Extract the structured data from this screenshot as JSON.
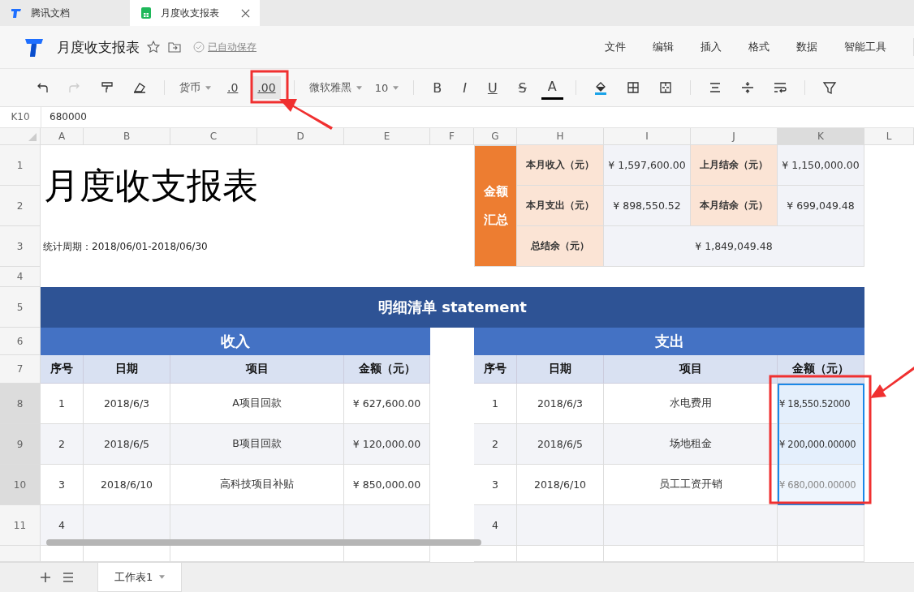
{
  "browser_tabs": [
    {
      "label": "腾讯文档",
      "selected": false
    },
    {
      "label": "月度收支报表",
      "selected": true
    }
  ],
  "document": {
    "title": "月度收支报表",
    "save_status": "已自动保存"
  },
  "menu": [
    "文件",
    "编辑",
    "插入",
    "格式",
    "数据",
    "智能工具"
  ],
  "toolbar": {
    "number_format": "货币",
    "decimal_buttons": [
      {
        "label": ".0",
        "selected": false
      },
      {
        "label": ".00",
        "selected": true
      }
    ],
    "font": "微软雅黑",
    "font_size": "10",
    "style_buttons": [
      "B",
      "I",
      "U",
      "S",
      "A"
    ]
  },
  "formula_bar": {
    "cell": "K10",
    "value": "680000"
  },
  "columns": [
    {
      "label": "A",
      "selected": false
    },
    {
      "label": "B",
      "selected": false
    },
    {
      "label": "C",
      "selected": false
    },
    {
      "label": "D",
      "selected": false
    },
    {
      "label": "E",
      "selected": false
    },
    {
      "label": "F",
      "selected": false
    },
    {
      "label": "G",
      "selected": false
    },
    {
      "label": "H",
      "selected": false
    },
    {
      "label": "I",
      "selected": false
    },
    {
      "label": "J",
      "selected": false
    },
    {
      "label": "K",
      "selected": true
    },
    {
      "label": "L",
      "selected": false
    }
  ],
  "rows": [
    {
      "label": "1",
      "selected": false
    },
    {
      "label": "2",
      "selected": false
    },
    {
      "label": "3",
      "selected": false
    },
    {
      "label": "4",
      "selected": false
    },
    {
      "label": "5",
      "selected": false
    },
    {
      "label": "6",
      "selected": false
    },
    {
      "label": "7",
      "selected": false
    },
    {
      "label": "8",
      "selected": true
    },
    {
      "label": "9",
      "selected": true
    },
    {
      "label": "10",
      "selected": true
    },
    {
      "label": "11",
      "selected": false
    }
  ],
  "sheet": {
    "title": "月度收支报表",
    "period": "统计周期：2018/06/01-2018/06/30",
    "summary": {
      "heading": [
        "金额",
        "汇总"
      ],
      "items": [
        {
          "label": "本月收入（元）",
          "value": "¥ 1,597,600.00"
        },
        {
          "label": "上月结余（元）",
          "value": "¥ 1,150,000.00"
        },
        {
          "label": "本月支出（元）",
          "value": "¥ 898,550.52"
        },
        {
          "label": "本月结余（元）",
          "value": "¥ 699,049.48"
        },
        {
          "label": "总结余（元）",
          "value": "¥ 1,849,049.48"
        }
      ]
    },
    "banner": "明细清单 statement",
    "income": {
      "title": "收入",
      "columns": [
        "序号",
        "日期",
        "项目",
        "金额（元）"
      ],
      "rows": [
        {
          "no": "1",
          "date": "2018/6/3",
          "item": "A项目回款",
          "amount": "¥ 627,600.00",
          "selected": false
        },
        {
          "no": "2",
          "date": "2018/6/5",
          "item": "B项目回款",
          "amount": "¥ 120,000.00",
          "selected": false
        },
        {
          "no": "3",
          "date": "2018/6/10",
          "item": "高科技项目补贴",
          "amount": "¥ 850,000.00",
          "selected": false
        },
        {
          "no": "4",
          "selected": false
        }
      ]
    },
    "expense": {
      "title": "支出",
      "columns": [
        "序号",
        "日期",
        "项目",
        "金额（元）"
      ],
      "rows": [
        {
          "no": "1",
          "date": "2018/6/3",
          "item": "水电费用",
          "amount": "¥ 18,550.52000",
          "selected": true,
          "active": false
        },
        {
          "no": "2",
          "date": "2018/6/5",
          "item": "场地租金",
          "amount": "¥ 200,000.00000",
          "selected": true,
          "active": false
        },
        {
          "no": "3",
          "date": "2018/6/10",
          "item": "员工工资开销",
          "amount": "¥ 680,000.00000",
          "selected": true,
          "active": true
        },
        {
          "no": "4",
          "selected": false
        }
      ]
    }
  },
  "sheet_tabs": [
    {
      "label": "工作表1",
      "selected": true
    }
  ]
}
